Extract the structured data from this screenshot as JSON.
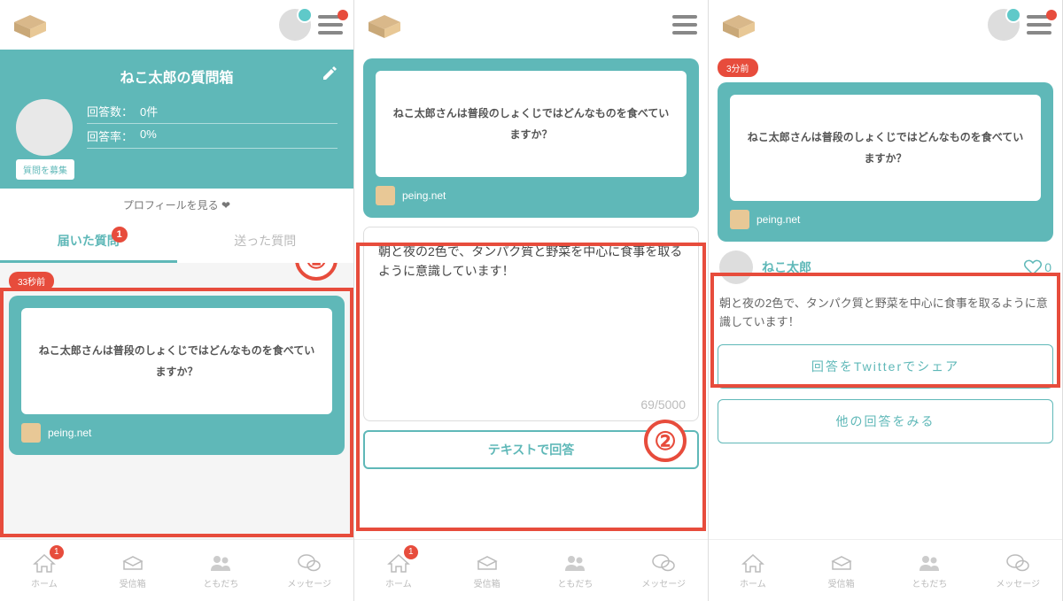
{
  "header": {
    "site": "peing.net"
  },
  "profile": {
    "title": "ねこ太郎の質問箱",
    "recruit": "質問を募集",
    "answer_count_label": "回答数：",
    "answer_count": "0件",
    "answer_rate_label": "回答率：",
    "answer_rate": "0%",
    "profile_link": "プロフィールを見る ❤"
  },
  "tabs": {
    "received": "届いた質問",
    "sent": "送った質問",
    "badge": "1"
  },
  "question": {
    "time1": "33秒前",
    "time3": "3分前",
    "text": "ねこ太郎さんは普段のしょくじではどんなものを食べていますか？"
  },
  "answer": {
    "input": "朝と夜の2色で、タンパク質と野菜を中心に食事を取るように意識しています！",
    "char_count": "69/5000",
    "submit": "テキストで回答",
    "posted": "朝と夜の2色で、タンパク質と野菜を中心に食事を取るように意識しています！"
  },
  "user": {
    "name": "ねこ太郎",
    "likes": "0"
  },
  "actions": {
    "share": "回答をTwitterでシェア",
    "others": "他の回答をみる"
  },
  "nav": {
    "home": "ホーム",
    "inbox": "受信箱",
    "friends": "ともだち",
    "message": "メッセージ",
    "badge": "1"
  }
}
